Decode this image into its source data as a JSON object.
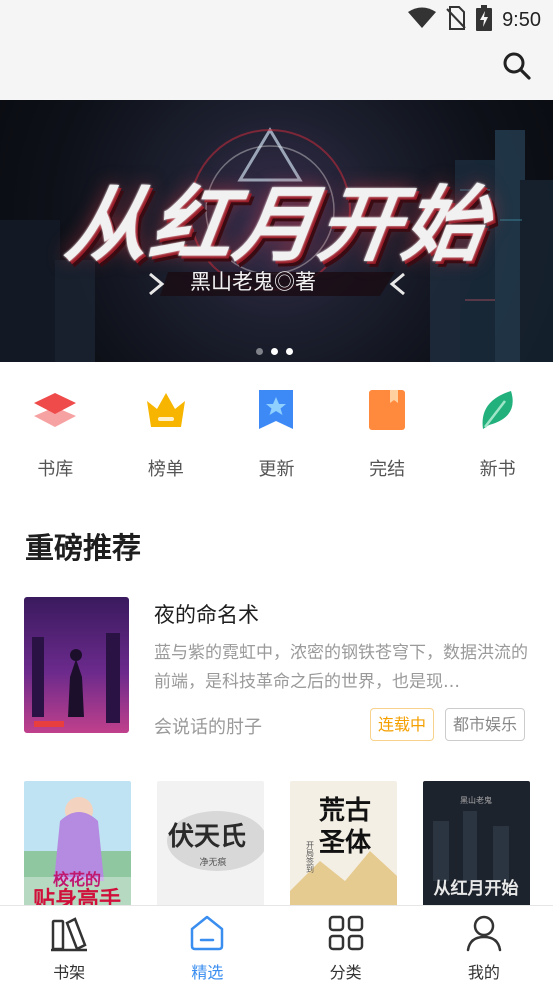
{
  "status_bar": {
    "time": "9:50",
    "icons": [
      "wifi-icon",
      "no-sim-icon",
      "battery-charging-icon"
    ]
  },
  "header": {
    "search_icon": "search-icon"
  },
  "banner": {
    "title": "从红月开始",
    "author": "黑山老鬼◎著",
    "slides": 3,
    "active_slide": 1
  },
  "categories": [
    {
      "label": "书库",
      "icon": "layers-icon",
      "color": "#f0504f"
    },
    {
      "label": "榜单",
      "icon": "crown-icon",
      "color": "#f7b500"
    },
    {
      "label": "更新",
      "icon": "bookmark-star-icon",
      "color": "#3d8af7"
    },
    {
      "label": "完结",
      "icon": "book-icon",
      "color": "#ff8a3d"
    },
    {
      "label": "新书",
      "icon": "leaf-icon",
      "color": "#22b07d"
    }
  ],
  "section": {
    "title": "重磅推荐"
  },
  "featured": {
    "cover_title": "夜的命名术",
    "title": "夜的命名术",
    "description": "蓝与紫的霓虹中，浓密的钢铁苍穹下，数据洪流的前端，是科技革命之后的世界，也是现…",
    "author": "会说话的肘子",
    "status_tag": "连载中",
    "genre_tag": "都市娱乐"
  },
  "covers": [
    {
      "title": "校花的贴身高手"
    },
    {
      "title": "伏天氏",
      "sub": "净无痕"
    },
    {
      "title": "荒古圣体",
      "sub": "开局签到"
    },
    {
      "title": "从红月开始",
      "sub": "黑山老鬼"
    }
  ],
  "bottom_nav": [
    {
      "label": "书架",
      "icon": "bookshelf-icon",
      "active": false
    },
    {
      "label": "精选",
      "icon": "home-icon",
      "active": true
    },
    {
      "label": "分类",
      "icon": "grid-icon",
      "active": false
    },
    {
      "label": "我的",
      "icon": "user-icon",
      "active": false
    }
  ],
  "colors": {
    "accent": "#3a8ef0",
    "tag_orange": "#f4a000",
    "banner_red": "#c72c3a"
  }
}
